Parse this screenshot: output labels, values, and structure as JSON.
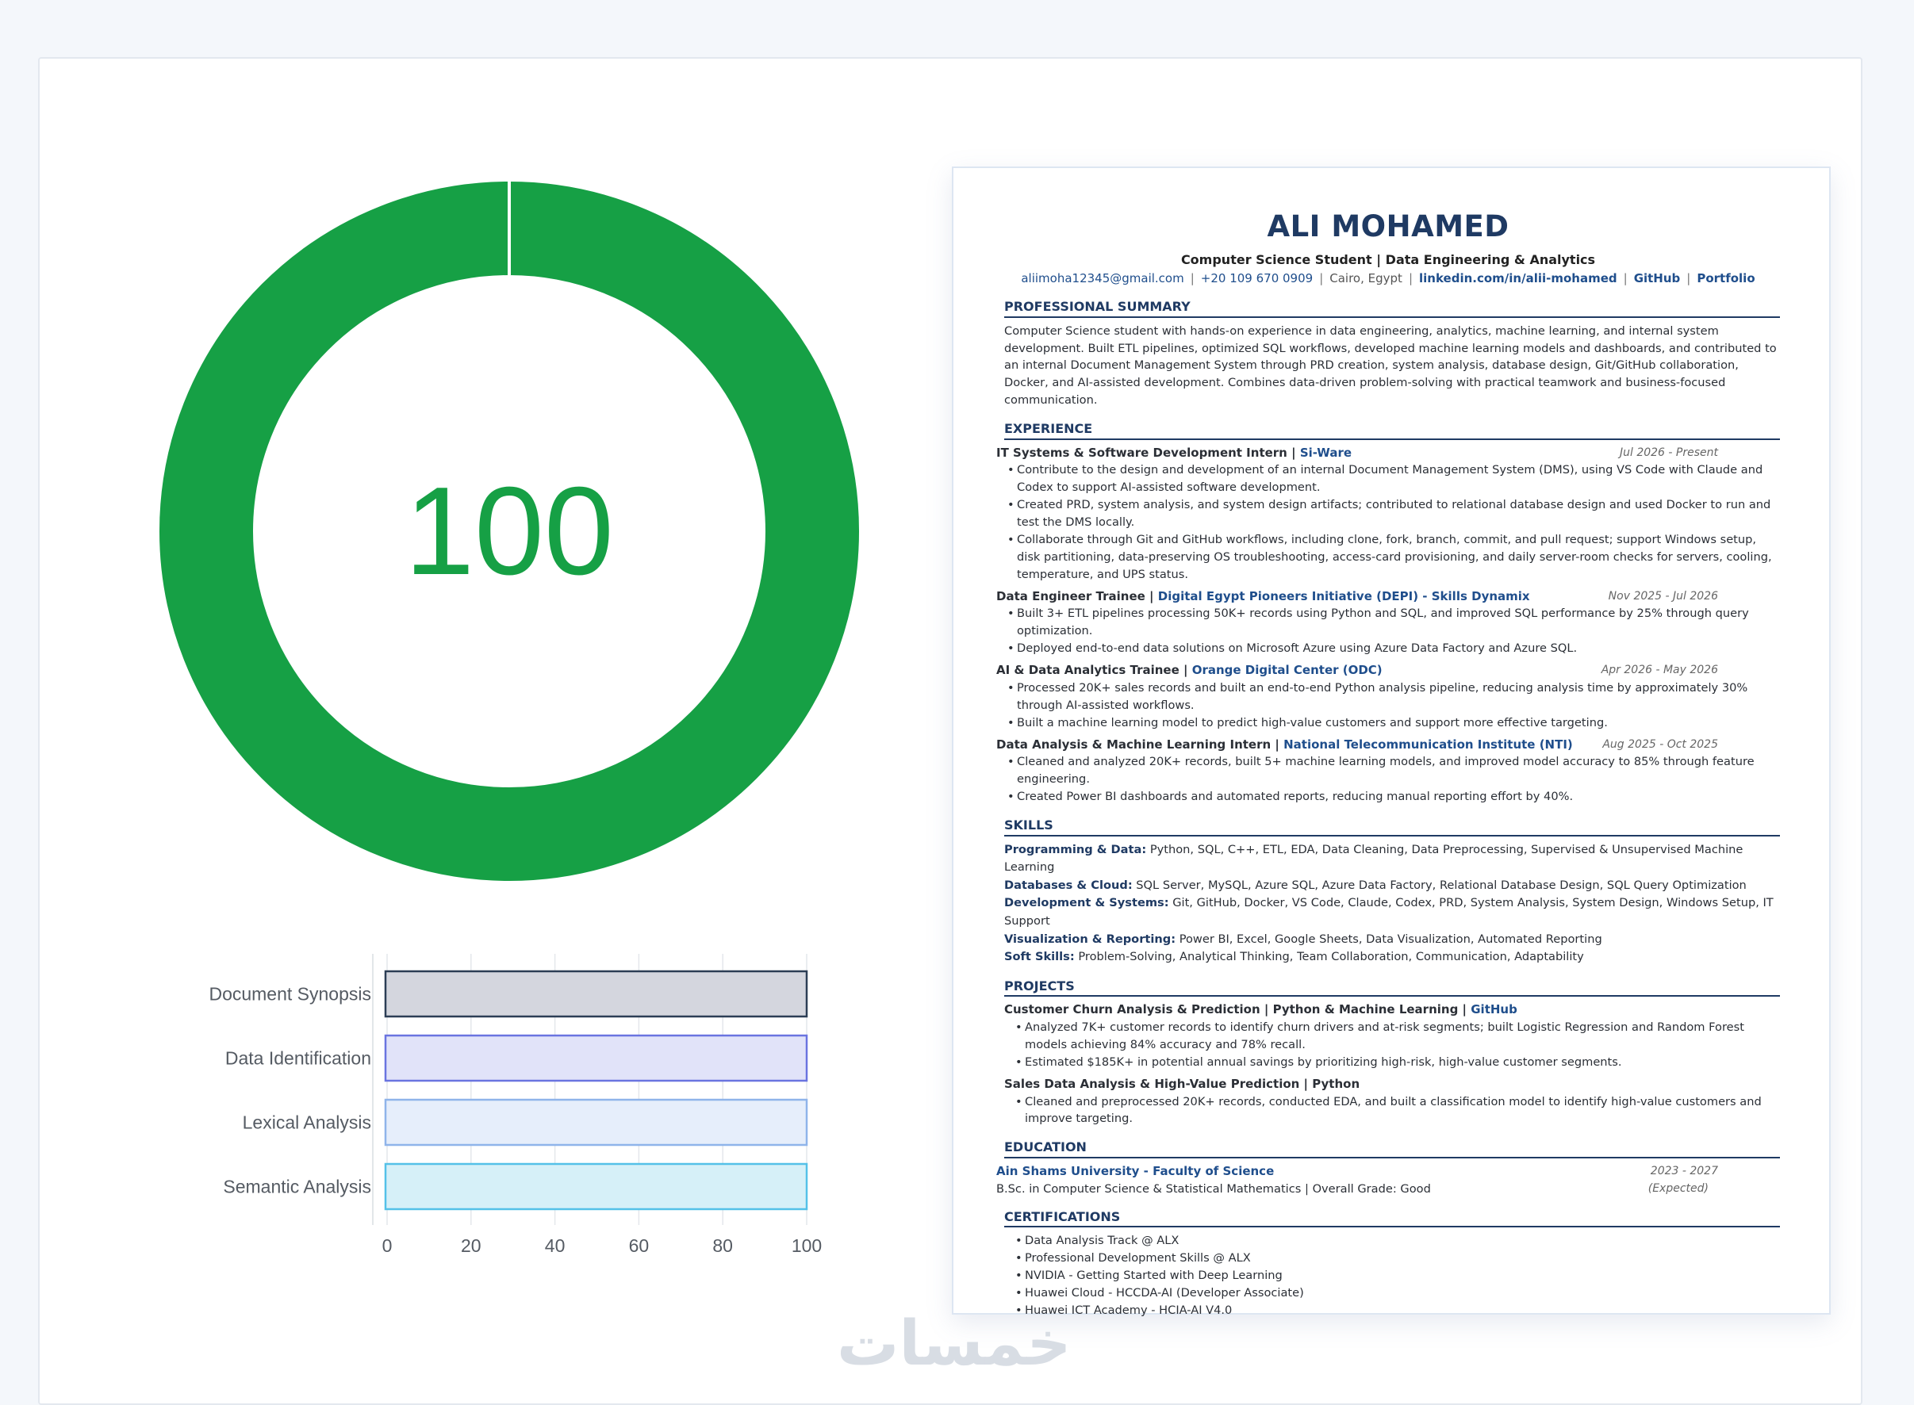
{
  "donut": {
    "score": "100",
    "percent": 100,
    "color": "#16a045"
  },
  "chart_data": {
    "type": "bar",
    "orientation": "horizontal",
    "categories": [
      "Document Synopsis",
      "Data Identification",
      "Lexical Analysis",
      "Semantic Analysis"
    ],
    "values": [
      100,
      100,
      100,
      100
    ],
    "xlim": [
      0,
      100
    ],
    "xticks": [
      "0",
      "20",
      "40",
      "60",
      "80",
      "100"
    ],
    "grid": true,
    "colors": {
      "fills": [
        "#d4d6de",
        "#e1e3f9",
        "#e6eefb",
        "#d6f0f8"
      ],
      "strokes": [
        "#2c3e55",
        "#6a74e0",
        "#8fb4ea",
        "#54c1e8"
      ]
    }
  },
  "resume": {
    "name": "ALI MOHAMED",
    "headline": "Computer Science Student | Data Engineering & Analytics",
    "contact": {
      "email": "aliimoha12345@gmail.com",
      "phone": "+20 109 670 0909",
      "location": "Cairo, Egypt",
      "linkedin": "linkedin.com/in/alii-mohamed",
      "github": "GitHub",
      "portfolio": "Portfolio",
      "sep": "|"
    },
    "summary_title": "PROFESSIONAL SUMMARY",
    "summary": "Computer Science student with hands-on experience in data engineering, analytics, machine learning, and internal system development. Built ETL pipelines, optimized SQL workflows, developed machine learning models and dashboards, and contributed to an internal Document Management System through PRD creation, system analysis, database design, Git/GitHub collaboration, Docker, and AI-assisted development. Combines data-driven problem-solving with practical teamwork and business-focused communication.",
    "experience_title": "EXPERIENCE",
    "experience": [
      {
        "role": "IT Systems & Software Development Intern",
        "org": "Si-Ware",
        "date": "Jul 2026 - Present",
        "bullets": [
          "Contribute to the design and development of an internal Document Management System (DMS), using VS Code with Claude and Codex to support AI-assisted software development.",
          "Created PRD, system analysis, and system design artifacts; contributed to relational database design and used Docker to run and test the DMS locally.",
          "Collaborate through Git and GitHub workflows, including clone, fork, branch, commit, and pull request; support Windows setup, disk partitioning, data-preserving OS troubleshooting, access-card provisioning, and daily server-room checks for servers, cooling, temperature, and UPS status."
        ]
      },
      {
        "role": "Data Engineer Trainee",
        "org": "Digital Egypt Pioneers Initiative (DEPI) - Skills Dynamix",
        "date": "Nov 2025 - Jul 2026",
        "bullets": [
          "Built 3+ ETL pipelines processing 50K+ records using Python and SQL, and improved SQL performance by 25% through query optimization.",
          "Deployed end-to-end data solutions on Microsoft Azure using Azure Data Factory and Azure SQL."
        ]
      },
      {
        "role": "AI & Data Analytics Trainee",
        "org": "Orange Digital Center (ODC)",
        "date": "Apr 2026 - May 2026",
        "bullets": [
          "Processed 20K+ sales records and built an end-to-end Python analysis pipeline, reducing analysis time by approximately 30% through AI-assisted workflows.",
          "Built a machine learning model to predict high-value customers and support more effective targeting."
        ]
      },
      {
        "role": "Data Analysis & Machine Learning Intern",
        "org": "National Telecommunication Institute (NTI)",
        "date": "Aug 2025 - Oct 2025",
        "bullets": [
          "Cleaned and analyzed 20K+ records, built 5+ machine learning models, and improved model accuracy to 85% through feature engineering.",
          "Created Power BI dashboards and automated reports, reducing manual reporting effort by 40%."
        ]
      }
    ],
    "skills_title": "SKILLS",
    "skills": [
      {
        "label": "Programming & Data:",
        "value": "Python, SQL, C++, ETL, EDA, Data Cleaning, Data Preprocessing, Supervised & Unsupervised Machine Learning"
      },
      {
        "label": "Databases & Cloud:",
        "value": "SQL Server, MySQL, Azure SQL, Azure Data Factory, Relational Database Design, SQL Query Optimization"
      },
      {
        "label": "Development & Systems:",
        "value": "Git, GitHub, Docker, VS Code, Claude, Codex, PRD, System Analysis, System Design, Windows Setup, IT Support"
      },
      {
        "label": "Visualization & Reporting:",
        "value": "Power BI, Excel, Google Sheets, Data Visualization, Automated Reporting"
      },
      {
        "label": "Soft Skills:",
        "value": "Problem-Solving, Analytical Thinking, Team Collaboration, Communication, Adaptability"
      }
    ],
    "projects_title": "PROJECTS",
    "projects": [
      {
        "title": "Customer Churn Analysis & Prediction | Python & Machine Learning |",
        "link": "GitHub",
        "bullets": [
          "Analyzed 7K+ customer records to identify churn drivers and at-risk segments; built Logistic Regression and Random Forest models achieving 84% accuracy and 78% recall.",
          "Estimated $185K+ in potential annual savings by prioritizing high-risk, high-value customer segments."
        ]
      },
      {
        "title": "Sales Data Analysis & High-Value Prediction | Python",
        "link": "",
        "bullets": [
          "Cleaned and preprocessed 20K+ records, conducted EDA, and built a classification model to identify high-value customers and improve targeting."
        ]
      }
    ],
    "education_title": "EDUCATION",
    "education": {
      "school": "Ain Shams University - Faculty of Science",
      "date": "2023 - 2027",
      "date_note": "(Expected)",
      "degree": "B.Sc. in Computer Science & Statistical Mathematics | Overall Grade: Good"
    },
    "certifications_title": "CERTIFICATIONS",
    "certifications": [
      "Data Analysis Track @ ALX",
      "Professional Development Skills @ ALX",
      "NVIDIA - Getting Started with Deep Learning",
      "Huawei Cloud - HCCDA-AI (Developer Associate)",
      "Huawei ICT Academy - HCIA-AI V4.0"
    ]
  },
  "watermark": "خمسات"
}
